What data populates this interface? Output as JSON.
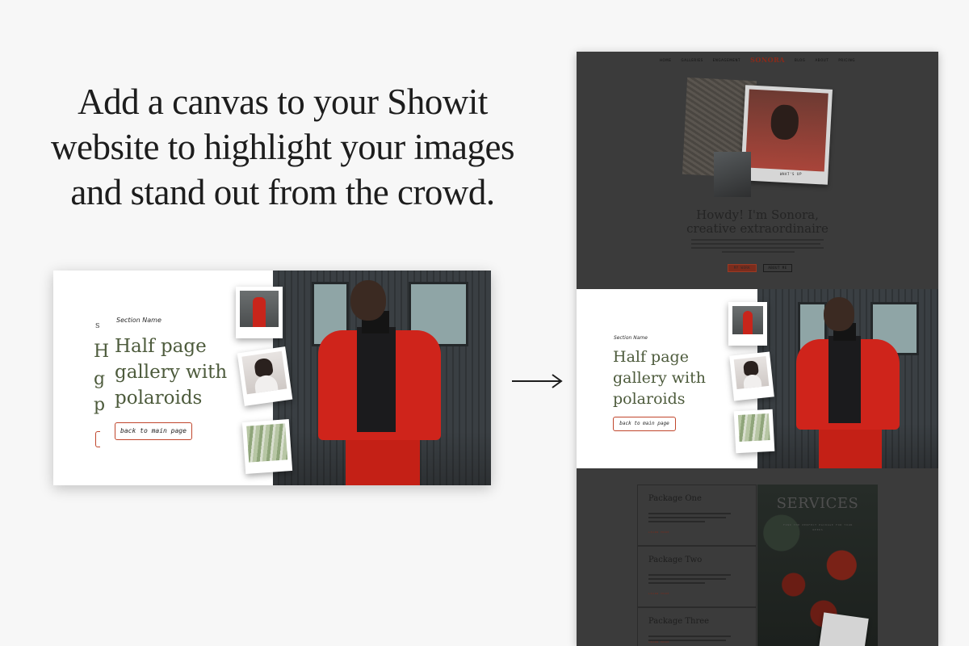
{
  "headline": {
    "line1": "Add a canvas to your Showit",
    "line2": "website to highlight your images",
    "line3": "and stand out from the crowd."
  },
  "canvas_block": {
    "section_name": "Section Name",
    "title_line1": "Half page",
    "title_line2": "gallery with",
    "title_line3": "polaroids",
    "button_label": "back to main page"
  },
  "site": {
    "logo": "SONORA",
    "nav_left": [
      "HOME",
      "GALLERIES",
      "ENGAGEMENT"
    ],
    "nav_right": [
      "BLOG",
      "ABOUT",
      "PRICING"
    ],
    "hero_caption": "WHAT'S UP",
    "howdy_line1": "Howdy! I'm Sonora,",
    "howdy_line2": "creative extraordinaire",
    "cta_primary": "MY WORK",
    "cta_secondary": "ABOUT ME",
    "services_title": "SERVICES",
    "services_subtitle": "FIND THE PERFECT PACKAGE FOR YOUR NEEDS",
    "packages": [
      {
        "name": "Package One",
        "link": "LEARN MORE"
      },
      {
        "name": "Package Two",
        "link": "LEARN MORE"
      },
      {
        "name": "Package Three",
        "link": "LEARN MORE"
      }
    ]
  },
  "colors": {
    "olive_title": "#4d5b3c",
    "accent_red": "#c0462c",
    "overlay_dark": "#3b3b3b",
    "page_bg": "#f7f7f7"
  },
  "icons": {
    "arrow": "arrow-right-icon"
  }
}
